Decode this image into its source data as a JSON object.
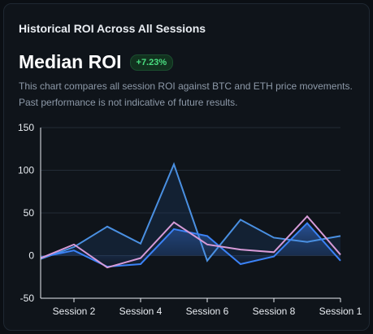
{
  "card": {
    "title": "Historical ROI Across All Sessions",
    "median_label": "Median ROI",
    "median_badge": "+7.23%",
    "description": "This chart compares all session ROI against BTC and ETH price movements. Past performance is not indicative of future results."
  },
  "colors": {
    "background": "#0b0f14",
    "card": "#0f141a",
    "badge_text": "#4ade80",
    "session_line": "#4a90e2",
    "btc_line": "#3b82f6",
    "eth_line": "#d79bd8"
  },
  "chart_data": {
    "type": "area",
    "ylim": [
      -50,
      150
    ],
    "yticks": [
      150,
      100,
      50,
      0,
      -50
    ],
    "x": [
      1,
      2,
      3,
      4,
      5,
      6,
      7,
      8,
      9,
      10
    ],
    "x_tick_positions": [
      2,
      4,
      6,
      8,
      10
    ],
    "xtick_labels": [
      "Session 2",
      "Session 4",
      "Session 6",
      "Session 8",
      "Session 1"
    ],
    "grid": true,
    "legend": "none",
    "series": [
      {
        "key": "session_roi",
        "values": [
          -4,
          10,
          34,
          14,
          107,
          -6,
          42,
          21,
          16,
          23
        ]
      },
      {
        "key": "btc",
        "values": [
          -2,
          6,
          -13,
          -10,
          31,
          23,
          -10,
          -1,
          38,
          -6
        ]
      },
      {
        "key": "eth",
        "values": [
          -3,
          13,
          -14,
          -3,
          39,
          13,
          7,
          4,
          46,
          1
        ]
      }
    ]
  }
}
